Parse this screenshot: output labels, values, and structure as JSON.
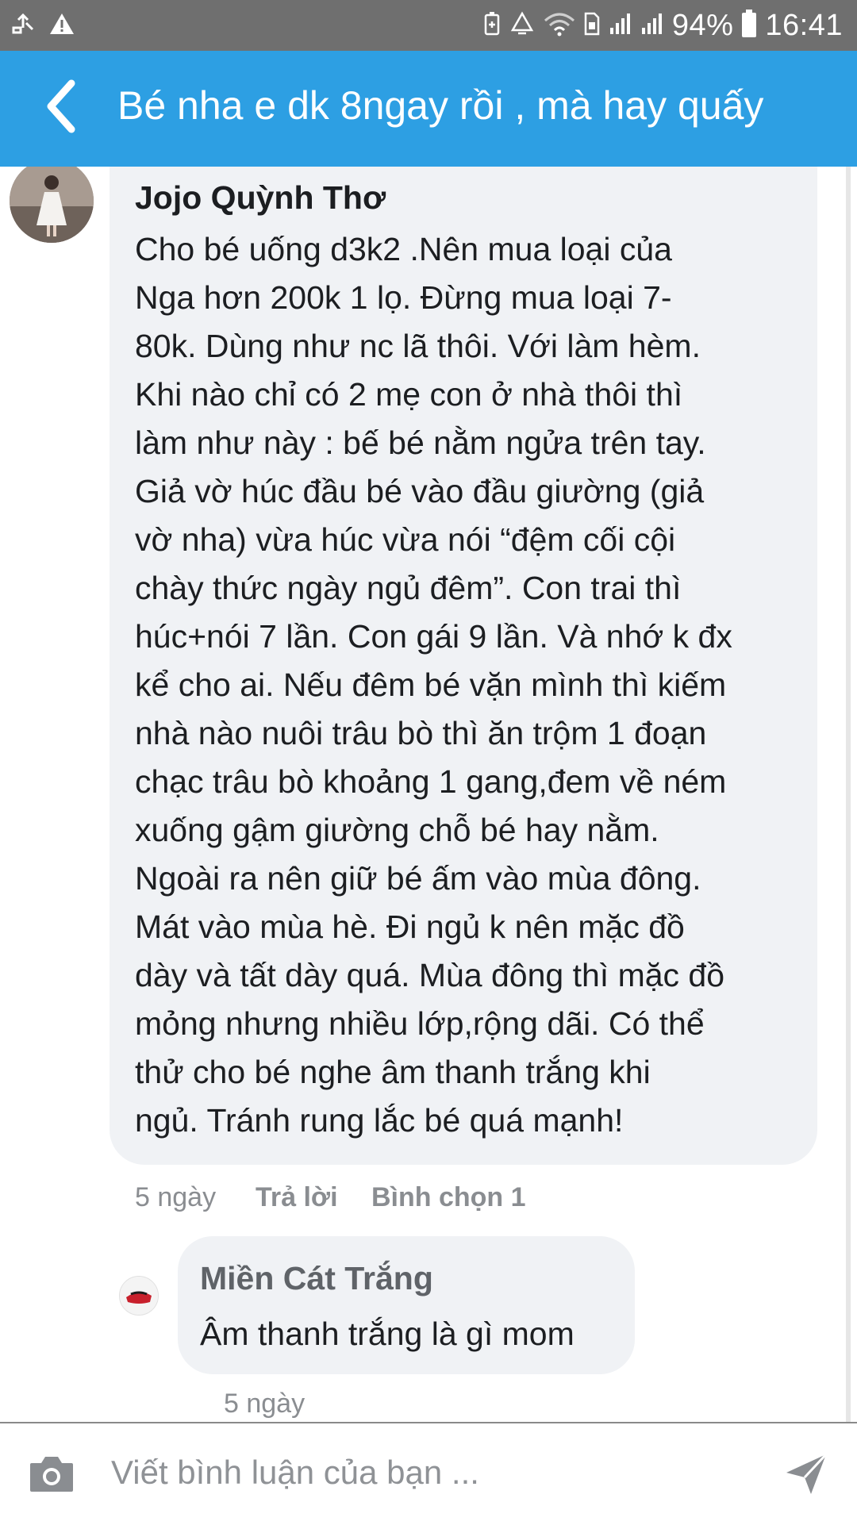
{
  "status_bar": {
    "battery_percent": "94%",
    "time": "16:41",
    "left_icons": [
      "usb-icon",
      "warning-icon"
    ],
    "right_icons": [
      "battery-saver-icon",
      "recycle-icon",
      "wifi-icon",
      "sim-icon",
      "signal-icon",
      "signal-icon",
      "battery-icon"
    ]
  },
  "app_bar": {
    "title": "Bé nha e dk 8ngay rồi , mà hay quấy",
    "back_icon": "chevron-left-icon"
  },
  "comment": {
    "author": "Jojo Quỳnh Thơ",
    "lines": [
      "Cho bé uống d3k2 .Nên mua loại của",
      "Nga hơn 200k 1 lọ. Đừng mua loại 7-",
      "80k. Dùng như nc lã thôi. Với làm hèm.",
      "Khi nào chỉ có 2 mẹ con ở nhà thôi thì",
      "làm như này : bế bé nằm ngửa trên tay.",
      "Giả vờ húc đầu bé vào đầu giường (giả",
      "vờ nha) vừa húc vừa nói “đệm cối cội",
      "chày thức ngày ngủ đêm”. Con trai thì",
      "húc+nói 7 lần. Con gái 9 lần. Và nhớ k đx",
      "kể cho ai. Nếu đêm bé vặn mình thì kiếm",
      "nhà nào nuôi trâu bò thì ăn trộm 1 đoạn",
      "chạc trâu bò khoảng 1 gang,đem về ném",
      "xuống gậm giường chỗ bé hay nằm.",
      "Ngoài ra nên giữ bé ấm vào mùa đông.",
      "Mát vào mùa hè. Đi ngủ k nên mặc đồ",
      "dày và tất dày quá. Mùa đông thì mặc đồ",
      "mỏng nhưng nhiều lớp,rộng dãi. Có thể",
      "thử cho bé nghe âm thanh trắng khi",
      "ngủ. Tránh rung lắc bé quá mạnh!"
    ],
    "time": "5 ngày",
    "reply_label": "Trả lời",
    "vote_label": "Bình chọn 1"
  },
  "reply": {
    "author": "Miền Cát Trắng",
    "text": "Âm thanh trắng là gì mom",
    "time": "5 ngày"
  },
  "composer": {
    "placeholder": "Viết bình luận của bạn ...",
    "camera_icon": "camera-icon",
    "send_icon": "send-icon"
  },
  "colors": {
    "status_bar": "#6f6f6f",
    "app_bar": "#2d9fe3",
    "bubble": "#f0f2f5",
    "meta_text": "#8a8d91"
  }
}
